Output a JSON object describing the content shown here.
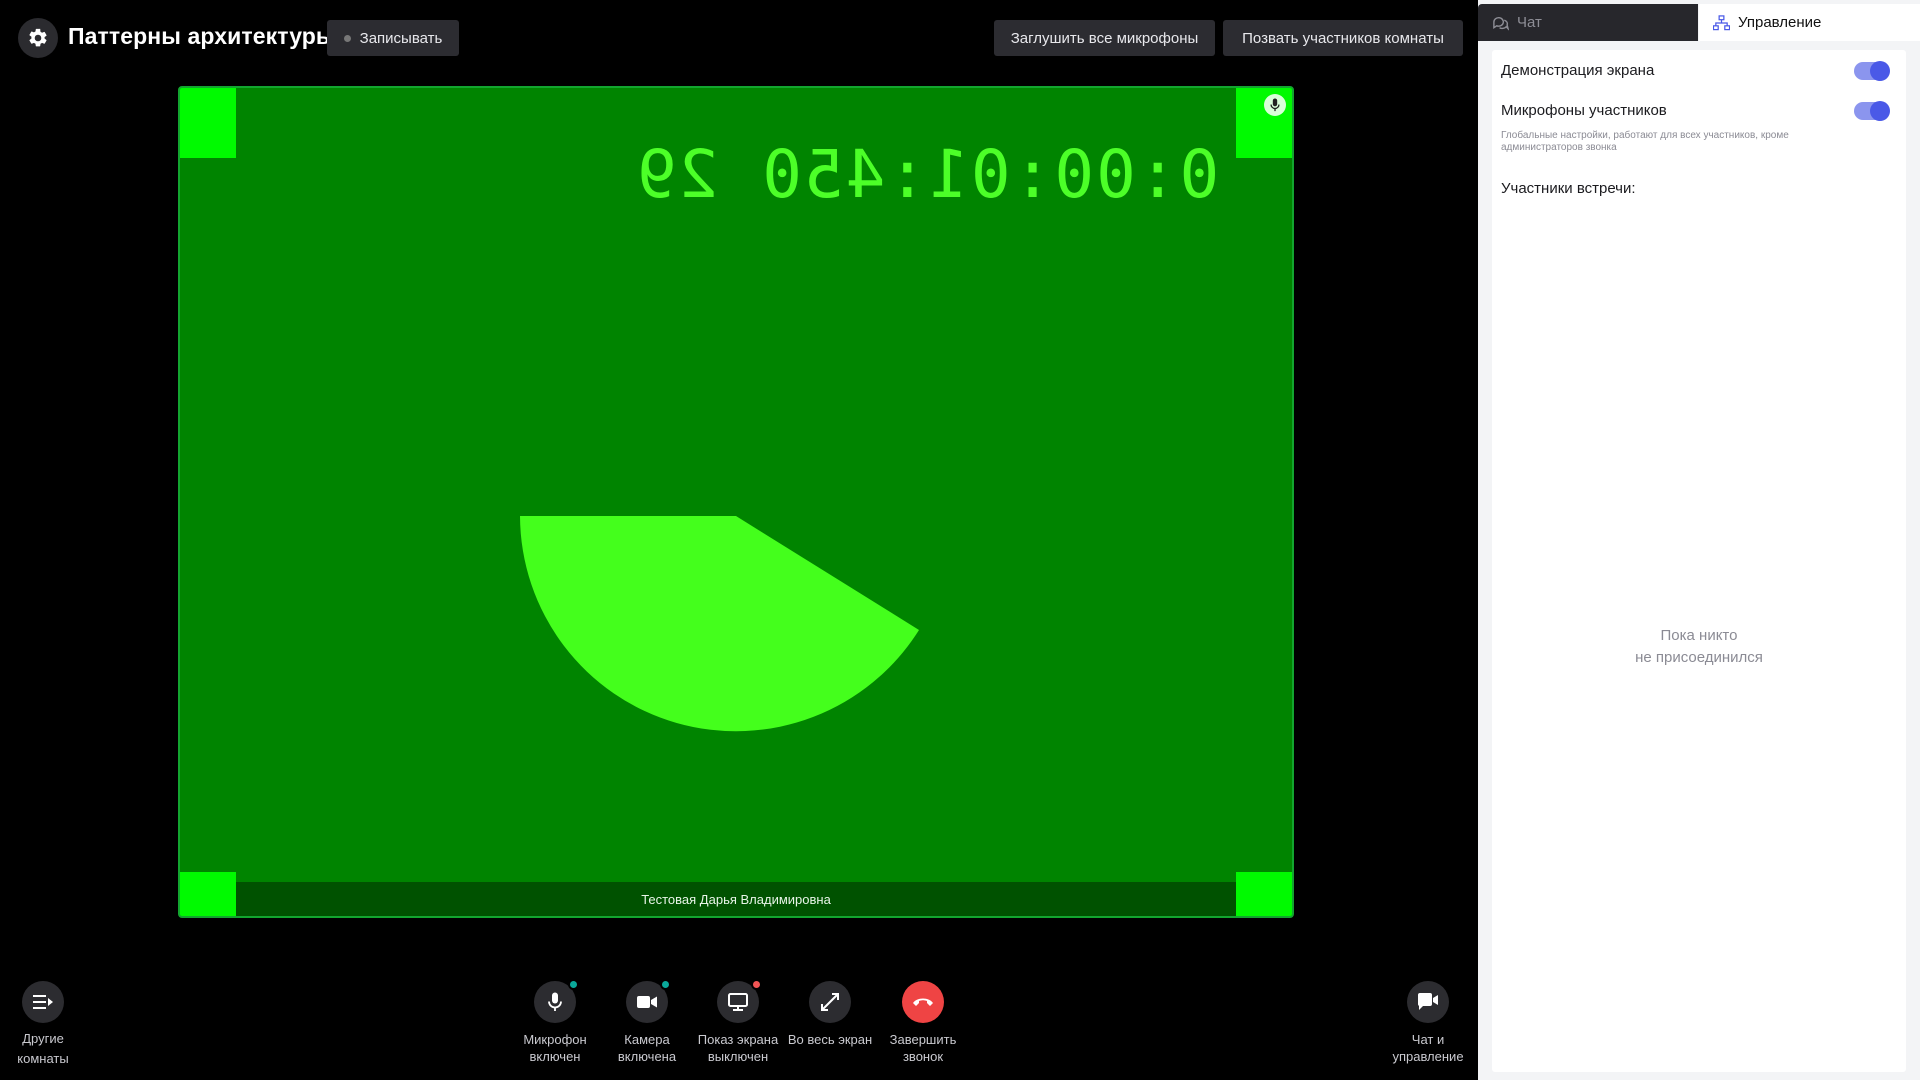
{
  "header": {
    "title": "Паттерны архитектуры",
    "record_label": "Записывать",
    "mute_all_label": "Заглушить все микрофоны",
    "invite_label": "Позвать участников комнаты",
    "settings_icon": "gear-icon"
  },
  "video": {
    "timer_text": "0:00:01:450 29",
    "participant_name": "Тестовая Дарья Владимировна",
    "background_color": "#008400",
    "shape_color": "#44ff1c",
    "corner_color": "#00fa00"
  },
  "controls": {
    "other_rooms_label": "Другие комнаты",
    "mic_label": "Микрофон включен",
    "camera_label": "Камера включена",
    "screen_label": "Показ экрана выключен",
    "fullscreen_label": "Во весь экран",
    "end_call_label": "Завершить звонок",
    "chat_manage_label": "Чат и управление",
    "status_on_color": "#0aa89a",
    "status_off_color": "#f05454",
    "end_call_color": "#ef4444"
  },
  "panel": {
    "tabs": [
      {
        "label": "Чат",
        "icon": "chat-icon",
        "active": false
      },
      {
        "label": "Управление",
        "icon": "hierarchy-icon",
        "active": true
      }
    ],
    "settings": [
      {
        "label": "Демонстрация экрана",
        "enabled": true
      },
      {
        "label": "Микрофоны участников",
        "enabled": true
      }
    ],
    "hint": "Глобальные настройки, работают для всех участников, кроме администраторов звонка",
    "participants_label": "Участники встречи:",
    "empty_line1": "Пока никто",
    "empty_line2": "не присоединился",
    "accent_color": "#4a59e7"
  }
}
